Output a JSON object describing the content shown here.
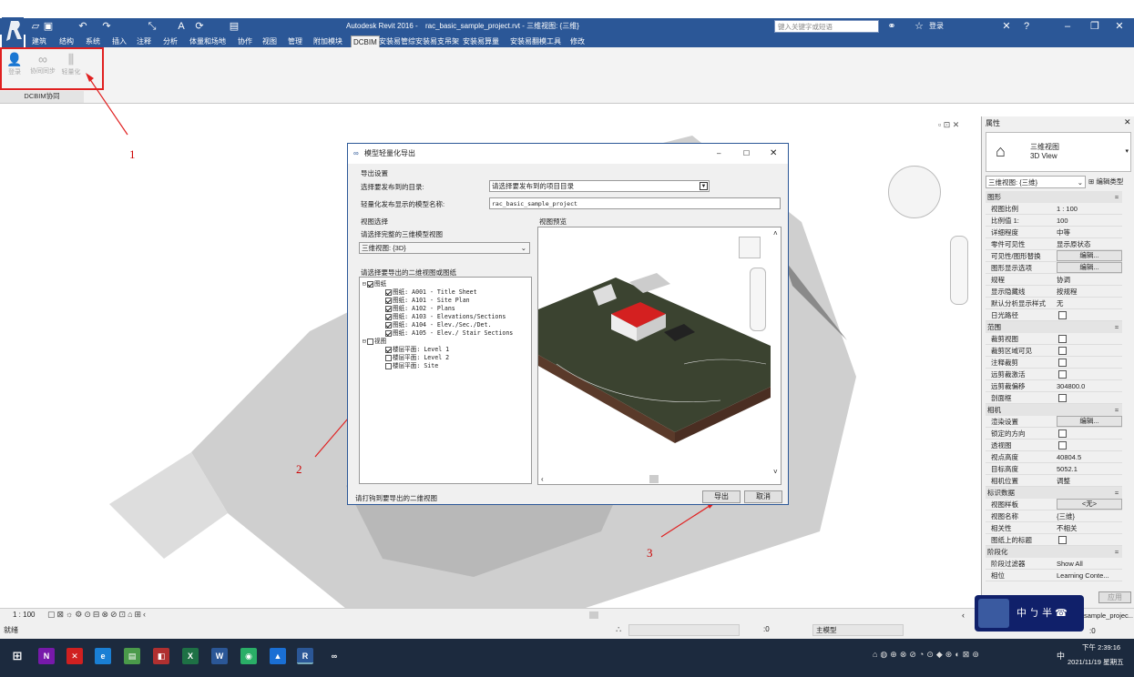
{
  "app": {
    "title": "Autodesk Revit 2016 -",
    "file": "rac_basic_sample_project.rvt - 三维视图: {三维}",
    "search_placeholder": "键入关键字或短语",
    "user_label": "登录",
    "help_label": "?"
  },
  "ribbon_tabs": [
    "建筑",
    "结构",
    "系统",
    "插入",
    "注释",
    "分析",
    "体量和场地",
    "协作",
    "视图",
    "管理",
    "附加模块",
    "DCBIM",
    "安装易管综",
    "安装易支吊架",
    "安装易算量",
    "安装易翻模工具",
    "修改"
  ],
  "ribbon_active_tab": "DCBIM",
  "ribbon_panel": {
    "buttons": [
      "登录",
      "协同同步",
      "轻量化"
    ],
    "panel_label": "DCBIM协同"
  },
  "annotations": [
    "1",
    "2",
    "3"
  ],
  "dialog": {
    "title": "模型轻量化导出",
    "section_export": "导出设置",
    "dir_label": "选择要发布到的目录:",
    "dir_value": "请选择要发布到的项目目录",
    "name_label": "轻量化发布显示的模型名称:",
    "name_value": "rac_basic_sample_project",
    "section_view": "视图选择",
    "view3d_label": "请选择完整的三维模型视图",
    "view3d_value": "三维视图: {3D}",
    "views2d_label": "请选择要导出的二维视图或图纸",
    "preview_label": "视图预览",
    "tree": {
      "sheets_label": "图纸",
      "sheets": [
        "图纸: A001 - Title Sheet",
        "图纸: A101 - Site Plan",
        "图纸: A102 - Plans",
        "图纸: A103 - Elevations/Sections",
        "图纸: A104 - Elev./Sec./Det.",
        "图纸: A105 - Elev./ Stair Sections"
      ],
      "views_label": "视图",
      "views": [
        "楼层平面: Level 1",
        "楼层平面: Level 2",
        "楼层平面: Site"
      ]
    },
    "hint": "请打钩到要导出的二维视图",
    "export_button": "导出",
    "cancel_button": "取消"
  },
  "properties": {
    "panel_title": "属性",
    "type_name": "三维视图",
    "type_sub": "3D View",
    "selector": "三维视图: {三维}",
    "edit_type": "编辑类型",
    "groups": [
      {
        "name": "图形",
        "rows": [
          {
            "k": "视图比例",
            "v": "1 : 100"
          },
          {
            "k": "比例值 1:",
            "v": "100"
          },
          {
            "k": "详细程度",
            "v": "中等"
          },
          {
            "k": "零件可见性",
            "v": "显示原状态"
          },
          {
            "k": "可见性/图形替换",
            "v": "编辑..."
          },
          {
            "k": "图形显示选项",
            "v": "编辑..."
          },
          {
            "k": "规程",
            "v": "协调"
          },
          {
            "k": "显示隐藏线",
            "v": "按规程"
          },
          {
            "k": "默认分析显示样式",
            "v": "无"
          },
          {
            "k": "日光路径",
            "v": ""
          }
        ]
      },
      {
        "name": "范围",
        "rows": [
          {
            "k": "裁剪视图",
            "v": ""
          },
          {
            "k": "裁剪区域可见",
            "v": ""
          },
          {
            "k": "注释裁剪",
            "v": ""
          },
          {
            "k": "远剪裁激活",
            "v": ""
          },
          {
            "k": "远剪裁偏移",
            "v": "304800.0"
          },
          {
            "k": "剖面框",
            "v": ""
          }
        ]
      },
      {
        "name": "相机",
        "rows": [
          {
            "k": "渲染设置",
            "v": "编辑..."
          },
          {
            "k": "锁定的方向",
            "v": ""
          },
          {
            "k": "透视图",
            "v": ""
          },
          {
            "k": "视点高度",
            "v": "40804.5"
          },
          {
            "k": "目标高度",
            "v": "5052.1"
          },
          {
            "k": "相机位置",
            "v": "调整"
          }
        ]
      },
      {
        "name": "标识数据",
        "rows": [
          {
            "k": "视图样板",
            "v": "<无>"
          },
          {
            "k": "视图名称",
            "v": "{三维}"
          },
          {
            "k": "相关性",
            "v": "不相关"
          },
          {
            "k": "图纸上的标题",
            "v": ""
          }
        ]
      },
      {
        "name": "阶段化",
        "rows": [
          {
            "k": "阶段过滤器",
            "v": "Show All"
          },
          {
            "k": "相位",
            "v": "Learning Conte..."
          }
        ]
      }
    ],
    "apply": "应用"
  },
  "status": {
    "scale": "1 : 100",
    "ready": "就绪",
    "coord": ":0",
    "model": "主模型",
    "project_name": "sample_projec...",
    "zero": ":0",
    "ime": "中 ㄅ 半 ☎"
  },
  "taskbar": {
    "time": "下午 2:39:16",
    "date": "2021/11/19 星期五",
    "lang": "中"
  }
}
